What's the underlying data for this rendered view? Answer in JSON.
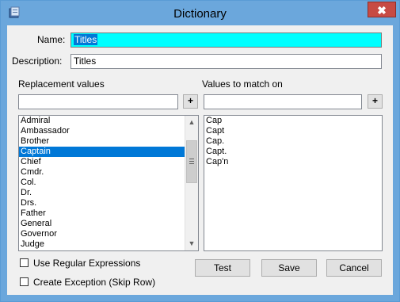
{
  "window": {
    "title": "Dictionary",
    "close_glyph": "✖"
  },
  "fields": {
    "name_label": "Name:",
    "name_value": "Titles",
    "description_label": "Description:",
    "description_value": "Titles"
  },
  "replacement": {
    "header": "Replacement values",
    "add_label": "+",
    "input_value": "",
    "items": [
      "Admiral",
      "Ambassador",
      "Brother",
      "Captain",
      "Chief",
      "Cmdr.",
      "Col.",
      "Dr.",
      "Drs.",
      "Father",
      "General",
      "Governor",
      "Judge"
    ],
    "selected": "Captain"
  },
  "match": {
    "header": "Values to match on",
    "add_label": "+",
    "input_value": "",
    "items": [
      "Cap",
      "Capt",
      "Cap.",
      "Capt.",
      "Cap'n"
    ]
  },
  "options": {
    "use_regex_label": "Use Regular Expressions",
    "use_regex_checked": false,
    "create_exception_label": "Create Exception (Skip Row)",
    "create_exception_checked": false
  },
  "buttons": {
    "test": "Test",
    "save": "Save",
    "cancel": "Cancel"
  },
  "icons": {
    "app": "dictionary-app-icon",
    "close": "close-icon",
    "scroll_up": "chevron-up-icon",
    "scroll_down": "chevron-down-icon"
  },
  "colors": {
    "titlebar": "#6ba7dc",
    "highlight_field": "#00ffff",
    "selection": "#0078d7",
    "close_button": "#c74b44"
  }
}
